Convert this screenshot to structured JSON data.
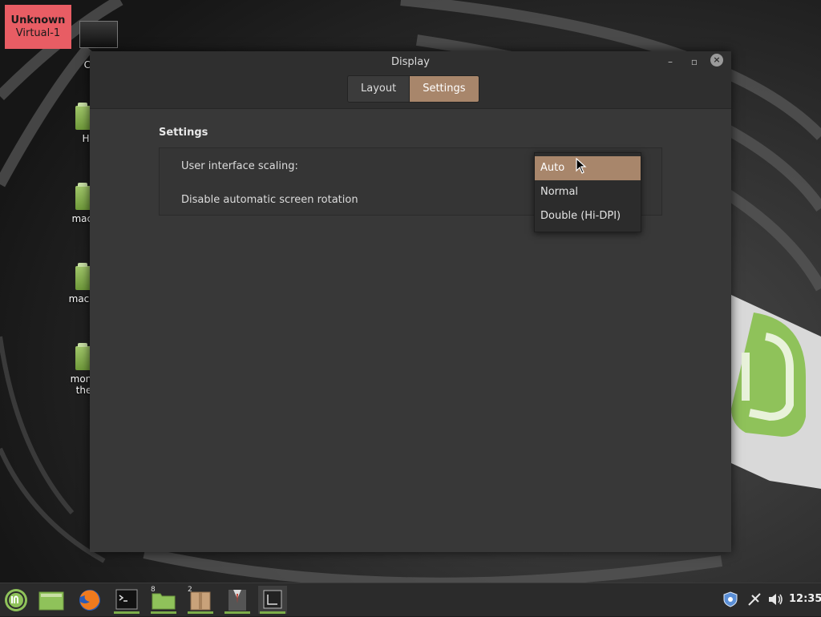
{
  "monitor": {
    "name": "Unknown",
    "output": "Virtual-1"
  },
  "desktop_icons": [
    {
      "label": "Cor",
      "icon": "computer-icon"
    },
    {
      "label": "H",
      "icon": "folder-icon"
    },
    {
      "label": "macO",
      "icon": "folder-icon"
    },
    {
      "label": "macOS",
      "icon": "folder-icon"
    },
    {
      "label": "monte",
      "label2": "ther",
      "icon": "folder-icon"
    }
  ],
  "window": {
    "title": "Display",
    "controls": {
      "minimize": "–",
      "maximize": "▫",
      "close": "×"
    },
    "tabs": [
      {
        "label": "Layout",
        "active": false
      },
      {
        "label": "Settings",
        "active": true
      }
    ],
    "section_title": "Settings",
    "rows": [
      {
        "label": "User interface scaling:"
      },
      {
        "label": "Disable automatic screen rotation"
      }
    ],
    "dropdown": {
      "options": [
        "Auto",
        "Normal",
        "Double (Hi-DPI)"
      ],
      "highlighted": "Auto"
    }
  },
  "taskbar": {
    "items": [
      {
        "name": "menu-button",
        "icon": "mint-logo-icon"
      },
      {
        "name": "show-desktop",
        "icon": "desktop-icon"
      },
      {
        "name": "firefox",
        "icon": "firefox-icon"
      },
      {
        "name": "terminal",
        "icon": "terminal-icon",
        "running": true
      },
      {
        "name": "files",
        "icon": "folder-icon",
        "badge": "8",
        "running": true
      },
      {
        "name": "archive",
        "icon": "archive-icon",
        "badge": "2",
        "running": true
      },
      {
        "name": "app",
        "icon": "suit-icon",
        "running": true
      },
      {
        "name": "display-settings",
        "icon": "display-icon",
        "running": true,
        "active": true
      }
    ],
    "clock": "12:35"
  },
  "colors": {
    "accent": "#a8866b",
    "monitor_label": "#e85d64",
    "running_indicator": "#7dae4a"
  }
}
